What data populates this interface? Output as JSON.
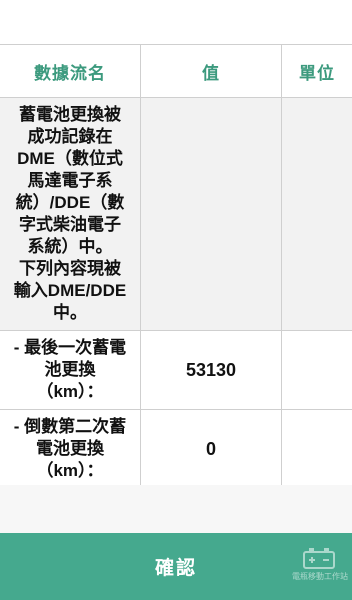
{
  "table": {
    "headers": {
      "name": "數據流名",
      "value": "值",
      "unit": "單位"
    },
    "rows": [
      {
        "name": "蓄電池更換被\n成功記錄在\nDME（數位式\n馬達電子系\n統）/DDE（數\n字式柴油電子\n系統）中。\n下列內容現被\n輸入DME/DDE\n中。",
        "value": "",
        "unit": ""
      },
      {
        "name": "- 最後一次蓄電\n池更換\n（km）：",
        "value": "53130",
        "unit": ""
      },
      {
        "name": "- 倒數第二次蓄\n電池更換\n（km）：",
        "value": "0",
        "unit": ""
      }
    ]
  },
  "footer": {
    "confirm_label": "確認"
  },
  "watermark": {
    "text": "電瓶移動工作站",
    "icon": "battery-icon"
  }
}
